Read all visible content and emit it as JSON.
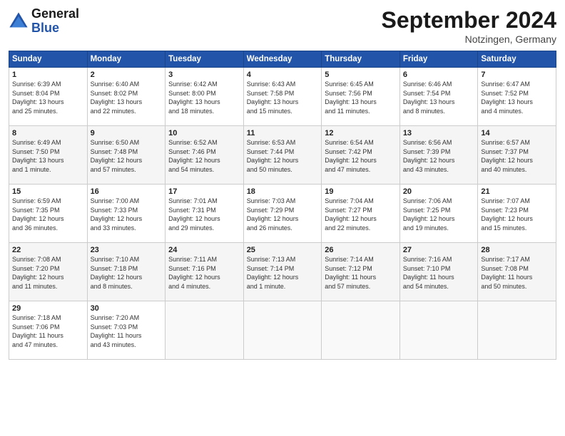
{
  "header": {
    "logo_line1": "General",
    "logo_line2": "Blue",
    "month": "September 2024",
    "location": "Notzingen, Germany"
  },
  "days_of_week": [
    "Sunday",
    "Monday",
    "Tuesday",
    "Wednesday",
    "Thursday",
    "Friday",
    "Saturday"
  ],
  "weeks": [
    [
      {
        "day": "1",
        "rise": "6:39 AM",
        "set": "8:04 PM",
        "hours": "13 hours",
        "mins": "25 minutes."
      },
      {
        "day": "2",
        "rise": "6:40 AM",
        "set": "8:02 PM",
        "hours": "13 hours",
        "mins": "22 minutes."
      },
      {
        "day": "3",
        "rise": "6:42 AM",
        "set": "8:00 PM",
        "hours": "13 hours",
        "mins": "18 minutes."
      },
      {
        "day": "4",
        "rise": "6:43 AM",
        "set": "7:58 PM",
        "hours": "13 hours",
        "mins": "15 minutes."
      },
      {
        "day": "5",
        "rise": "6:45 AM",
        "set": "7:56 PM",
        "hours": "13 hours",
        "mins": "11 minutes."
      },
      {
        "day": "6",
        "rise": "6:46 AM",
        "set": "7:54 PM",
        "hours": "13 hours",
        "mins": "8 minutes."
      },
      {
        "day": "7",
        "rise": "6:47 AM",
        "set": "7:52 PM",
        "hours": "13 hours",
        "mins": "4 minutes."
      }
    ],
    [
      {
        "day": "8",
        "rise": "6:49 AM",
        "set": "7:50 PM",
        "hours": "13 hours",
        "mins": "1 minute."
      },
      {
        "day": "9",
        "rise": "6:50 AM",
        "set": "7:48 PM",
        "hours": "12 hours",
        "mins": "57 minutes."
      },
      {
        "day": "10",
        "rise": "6:52 AM",
        "set": "7:46 PM",
        "hours": "12 hours",
        "mins": "54 minutes."
      },
      {
        "day": "11",
        "rise": "6:53 AM",
        "set": "7:44 PM",
        "hours": "12 hours",
        "mins": "50 minutes."
      },
      {
        "day": "12",
        "rise": "6:54 AM",
        "set": "7:42 PM",
        "hours": "12 hours",
        "mins": "47 minutes."
      },
      {
        "day": "13",
        "rise": "6:56 AM",
        "set": "7:39 PM",
        "hours": "12 hours",
        "mins": "43 minutes."
      },
      {
        "day": "14",
        "rise": "6:57 AM",
        "set": "7:37 PM",
        "hours": "12 hours",
        "mins": "40 minutes."
      }
    ],
    [
      {
        "day": "15",
        "rise": "6:59 AM",
        "set": "7:35 PM",
        "hours": "12 hours",
        "mins": "36 minutes."
      },
      {
        "day": "16",
        "rise": "7:00 AM",
        "set": "7:33 PM",
        "hours": "12 hours",
        "mins": "33 minutes."
      },
      {
        "day": "17",
        "rise": "7:01 AM",
        "set": "7:31 PM",
        "hours": "12 hours",
        "mins": "29 minutes."
      },
      {
        "day": "18",
        "rise": "7:03 AM",
        "set": "7:29 PM",
        "hours": "12 hours",
        "mins": "26 minutes."
      },
      {
        "day": "19",
        "rise": "7:04 AM",
        "set": "7:27 PM",
        "hours": "12 hours",
        "mins": "22 minutes."
      },
      {
        "day": "20",
        "rise": "7:06 AM",
        "set": "7:25 PM",
        "hours": "12 hours",
        "mins": "19 minutes."
      },
      {
        "day": "21",
        "rise": "7:07 AM",
        "set": "7:23 PM",
        "hours": "12 hours",
        "mins": "15 minutes."
      }
    ],
    [
      {
        "day": "22",
        "rise": "7:08 AM",
        "set": "7:20 PM",
        "hours": "12 hours",
        "mins": "11 minutes."
      },
      {
        "day": "23",
        "rise": "7:10 AM",
        "set": "7:18 PM",
        "hours": "12 hours",
        "mins": "8 minutes."
      },
      {
        "day": "24",
        "rise": "7:11 AM",
        "set": "7:16 PM",
        "hours": "12 hours",
        "mins": "4 minutes."
      },
      {
        "day": "25",
        "rise": "7:13 AM",
        "set": "7:14 PM",
        "hours": "12 hours",
        "mins": "1 minute."
      },
      {
        "day": "26",
        "rise": "7:14 AM",
        "set": "7:12 PM",
        "hours": "11 hours",
        "mins": "57 minutes."
      },
      {
        "day": "27",
        "rise": "7:16 AM",
        "set": "7:10 PM",
        "hours": "11 hours",
        "mins": "54 minutes."
      },
      {
        "day": "28",
        "rise": "7:17 AM",
        "set": "7:08 PM",
        "hours": "11 hours",
        "mins": "50 minutes."
      }
    ],
    [
      {
        "day": "29",
        "rise": "7:18 AM",
        "set": "7:06 PM",
        "hours": "11 hours",
        "mins": "47 minutes."
      },
      {
        "day": "30",
        "rise": "7:20 AM",
        "set": "7:03 PM",
        "hours": "11 hours",
        "mins": "43 minutes."
      },
      null,
      null,
      null,
      null,
      null
    ]
  ]
}
